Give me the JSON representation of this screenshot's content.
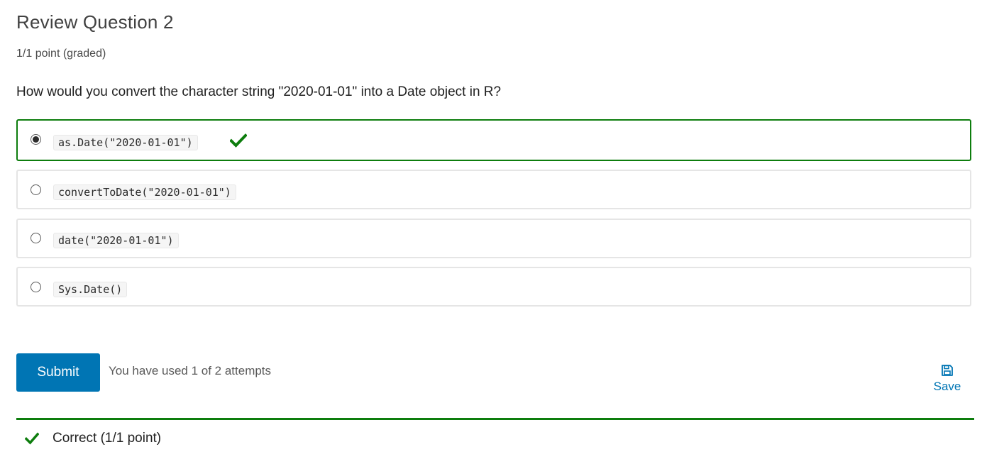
{
  "problem": {
    "title": "Review Question 2",
    "points": "1/1 point (graded)",
    "question": "How would you convert the character string \"2020-01-01\" into a Date object in R?"
  },
  "choices": [
    {
      "code": "as.Date(\"2020-01-01\")",
      "selected": true,
      "correct": true
    },
    {
      "code": "convertToDate(\"2020-01-01\")",
      "selected": false,
      "correct": false
    },
    {
      "code": "date(\"2020-01-01\")",
      "selected": false,
      "correct": false
    },
    {
      "code": "Sys.Date()",
      "selected": false,
      "correct": false
    }
  ],
  "actions": {
    "submit_label": "Submit",
    "attempts_text": "You have used 1 of 2 attempts",
    "save_label": "Save"
  },
  "feedback": {
    "text": "Correct (1/1 point)",
    "status": "correct"
  },
  "colors": {
    "accent_blue": "#0075b4",
    "correct_green": "#0d7d0d",
    "choice_border": "#e5e5e5"
  },
  "icons": {
    "correct": "check-icon",
    "save": "floppy-disk-icon"
  }
}
